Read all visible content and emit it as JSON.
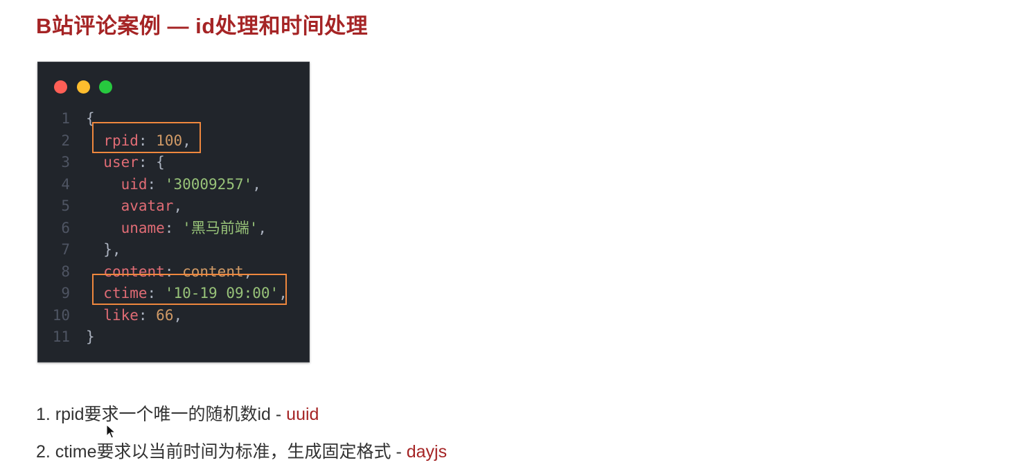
{
  "page": {
    "title": "B站评论案例 — id处理和时间处理"
  },
  "code_window": {
    "window_buttons": [
      "close-dot",
      "minimize-dot",
      "maximize-dot"
    ],
    "colors": {
      "background": "#21252b",
      "key": "#e06c75",
      "number": "#d19a66",
      "string": "#98c379",
      "punctuation": "#abb2bf",
      "highlight_box": "#f0883e"
    },
    "lines": [
      {
        "num": "1",
        "parts": [
          {
            "t": "{",
            "c": "p"
          }
        ]
      },
      {
        "num": "2",
        "parts": [
          {
            "t": "  ",
            "c": "p"
          },
          {
            "t": "rpid",
            "c": "k"
          },
          {
            "t": ": ",
            "c": "p"
          },
          {
            "t": "100",
            "c": "n"
          },
          {
            "t": ",",
            "c": "p"
          }
        ]
      },
      {
        "num": "3",
        "parts": [
          {
            "t": "  ",
            "c": "p"
          },
          {
            "t": "user",
            "c": "k"
          },
          {
            "t": ": {",
            "c": "p"
          }
        ]
      },
      {
        "num": "4",
        "parts": [
          {
            "t": "    ",
            "c": "p"
          },
          {
            "t": "uid",
            "c": "k"
          },
          {
            "t": ": ",
            "c": "p"
          },
          {
            "t": "'30009257'",
            "c": "s"
          },
          {
            "t": ",",
            "c": "p"
          }
        ]
      },
      {
        "num": "5",
        "parts": [
          {
            "t": "    ",
            "c": "p"
          },
          {
            "t": "avatar",
            "c": "k"
          },
          {
            "t": ",",
            "c": "p"
          }
        ]
      },
      {
        "num": "6",
        "parts": [
          {
            "t": "    ",
            "c": "p"
          },
          {
            "t": "uname",
            "c": "k"
          },
          {
            "t": ": ",
            "c": "p"
          },
          {
            "t": "'黑马前端'",
            "c": "s"
          },
          {
            "t": ",",
            "c": "p"
          }
        ]
      },
      {
        "num": "7",
        "parts": [
          {
            "t": "  },",
            "c": "p"
          }
        ]
      },
      {
        "num": "8",
        "parts": [
          {
            "t": "  ",
            "c": "p"
          },
          {
            "t": "content",
            "c": "k"
          },
          {
            "t": ": ",
            "c": "p"
          },
          {
            "t": "content",
            "c": "n"
          },
          {
            "t": ",",
            "c": "p"
          }
        ]
      },
      {
        "num": "9",
        "parts": [
          {
            "t": "  ",
            "c": "p"
          },
          {
            "t": "ctime",
            "c": "k"
          },
          {
            "t": ": ",
            "c": "p"
          },
          {
            "t": "'10-19 09:00'",
            "c": "s"
          },
          {
            "t": ",",
            "c": "p"
          }
        ]
      },
      {
        "num": "10",
        "parts": [
          {
            "t": "  ",
            "c": "p"
          },
          {
            "t": "like",
            "c": "k"
          },
          {
            "t": ": ",
            "c": "p"
          },
          {
            "t": "66",
            "c": "n"
          },
          {
            "t": ",",
            "c": "p"
          }
        ]
      },
      {
        "num": "11",
        "parts": [
          {
            "t": "}",
            "c": "p"
          }
        ]
      }
    ],
    "highlighted_lines": [
      "2",
      "9"
    ]
  },
  "notes": [
    {
      "text": "1. rpid要求一个唯一的随机数id  - ",
      "accent": "uuid"
    },
    {
      "text": "2. ctime要求以当前时间为标准，生成固定格式 - ",
      "accent": "dayjs"
    }
  ]
}
